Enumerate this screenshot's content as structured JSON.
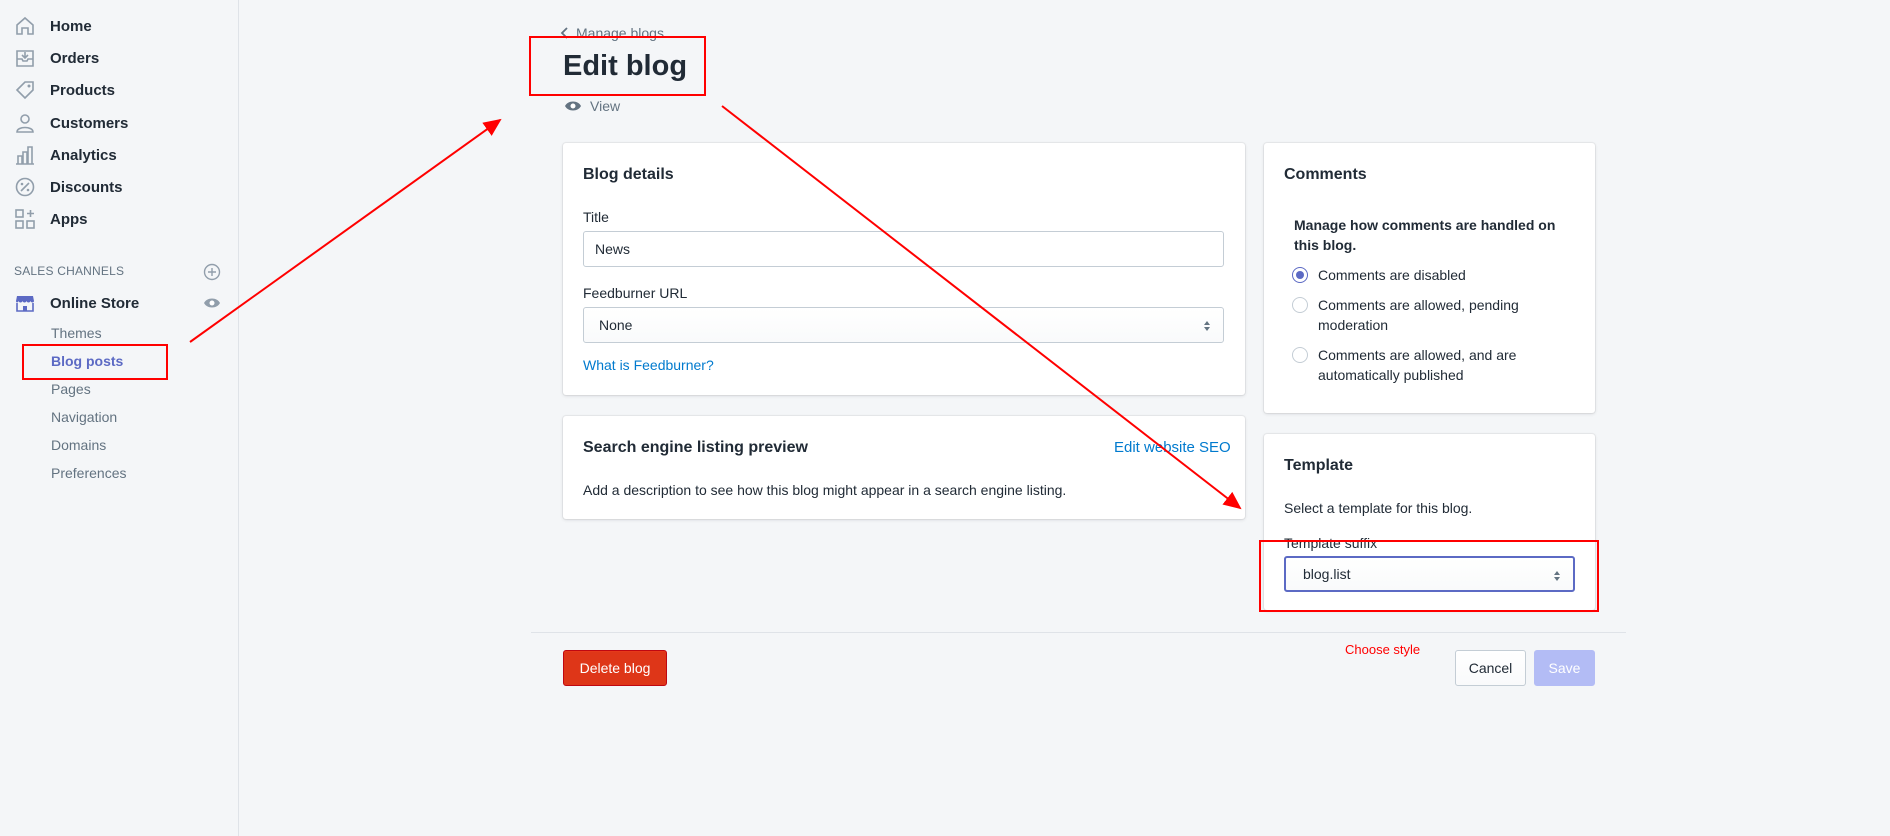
{
  "sidebar": {
    "nav": [
      {
        "label": "Home",
        "icon": "home-icon"
      },
      {
        "label": "Orders",
        "icon": "orders-icon"
      },
      {
        "label": "Products",
        "icon": "tag-icon"
      },
      {
        "label": "Customers",
        "icon": "person-icon"
      },
      {
        "label": "Analytics",
        "icon": "bar-chart-icon"
      },
      {
        "label": "Discounts",
        "icon": "discount-icon"
      },
      {
        "label": "Apps",
        "icon": "apps-icon"
      }
    ],
    "section_label": "SALES CHANNELS",
    "online_store": "Online Store",
    "sub_items": [
      "Themes",
      "Blog posts",
      "Pages",
      "Navigation",
      "Domains",
      "Preferences"
    ]
  },
  "header": {
    "back_label": "Manage blogs",
    "title": "Edit blog",
    "view_label": "View"
  },
  "blog_details": {
    "title": "Blog details",
    "title_label": "Title",
    "title_value": "News",
    "feedburner_label": "Feedburner URL",
    "feedburner_value": "None",
    "feedburner_link": "What is Feedburner?"
  },
  "seo": {
    "title": "Search engine listing preview",
    "edit_link": "Edit website SEO",
    "description": "Add a description to see how this blog might appear in a search engine listing."
  },
  "comments": {
    "title": "Comments",
    "prompt": "Manage how comments are handled on this blog.",
    "options": [
      {
        "label_line1": "Comments are disabled",
        "label_line2": "",
        "checked": true
      },
      {
        "label_line1": "Comments are allowed, pending",
        "label_line2": "moderation",
        "checked": false
      },
      {
        "label_line1": "Comments are allowed, and are",
        "label_line2": "automatically published",
        "checked": false
      }
    ]
  },
  "template": {
    "title": "Template",
    "description": "Select a template for this blog.",
    "suffix_label": "Template suffix",
    "suffix_value": "blog.list"
  },
  "footer": {
    "delete_label": "Delete blog",
    "cancel_label": "Cancel",
    "save_label": "Save"
  },
  "annotation": {
    "note": "Choose style",
    "color": "#ff0000"
  },
  "colors": {
    "accent": "#5c6ac4",
    "danger": "#de3618",
    "link": "#007ace",
    "save_disabled": "#b3bcf5"
  }
}
